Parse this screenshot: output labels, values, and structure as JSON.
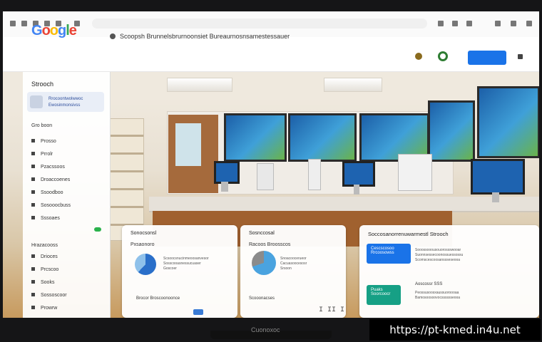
{
  "header": {
    "logo": "Google",
    "logo_colors": [
      "#4285f4",
      "#ea4335",
      "#fbbc05",
      "#4285f4",
      "#34a853",
      "#ea4335"
    ],
    "breadcrumb": "Scoopsh Brunnelsbrurnoonsiet Bureaurnosnsamestessauer",
    "button_label": "",
    "accent": "#1a73e8"
  },
  "sidebar": {
    "title": "Strooch",
    "card_text": "Rrocoontwolwwoc Ewosinmonsivss",
    "section1": "Gro boon",
    "items1": [
      "Prosso",
      "Prrolr",
      "Pzacssoos",
      "Droaccoenes",
      "Ssoodboo",
      "Sosooocbuss",
      "Sssoaes"
    ],
    "section2": "Hrazacooss",
    "items2": [
      "Drioces",
      "Prcscoo",
      "Sooks",
      "Sossoscoor",
      "Prowrw"
    ],
    "badge_color": "#2bb24c"
  },
  "cards": {
    "left": {
      "title": "Sonocsonsl",
      "sub": "Pxsaonoro",
      "lines": [
        "Scsoocsnucinmeoosanvesor",
        "Sosscooasnessucuaser",
        "Goscoer"
      ],
      "footer": "Brocor Broscoonoonce"
    },
    "middle": {
      "title": "Sosnccosal",
      "sub": "Racoos Broosscos",
      "lines": [
        "Snoacoocerueor",
        "Cacuasoocesosr",
        "Srsoon"
      ],
      "footer": "Scooonacses",
      "stat": "I II I"
    },
    "right": {
      "title": "Soccosanorrenuwarmestl Strooch",
      "tag1": "Cescscosoo Rrcoosowss",
      "tag2": "Puaks Soorcoocr",
      "tag1_color": "#1a73e8",
      "tag2_color": "#16a085",
      "lines1": [
        "Sooossooousouorossswooar",
        "Suonnsessecoonossuessossu",
        "Scomscescoosanssseseooa"
      ],
      "lines2_title": "Aoscossr SSS",
      "lines2": [
        "Peossusoosxaussuoroooaa",
        "Bamosoosoovocsssssseooa"
      ]
    }
  },
  "frame": {
    "brand": "Cuonoxoc"
  },
  "watermark": "https://pt-kmed.in4u.net"
}
